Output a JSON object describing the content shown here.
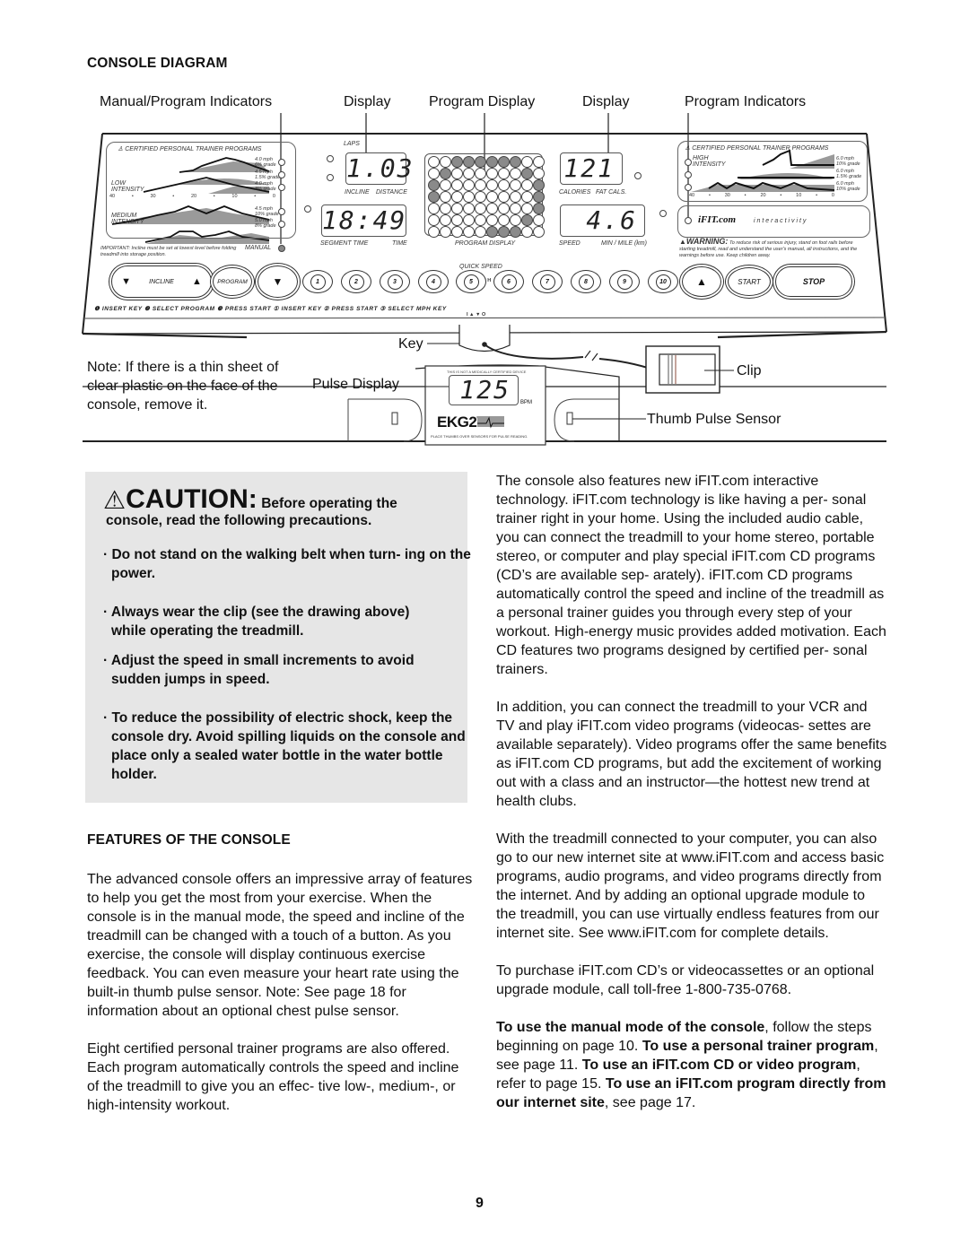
{
  "page": {
    "number": "9"
  },
  "console_diagram": {
    "heading": "CONSOLE DIAGRAM",
    "callouts_top": [
      "Manual/Program Indicators",
      "Display",
      "Program Display",
      "Display",
      "Program Indicators"
    ],
    "callouts_bottom": {
      "key": "Key",
      "pulse_display": "Pulse Display",
      "clip": "Clip",
      "thumb_pulse_sensor": "Thumb Pulse Sensor"
    },
    "note": "Note: If there is a thin sheet of clear plastic on the face of the console, remove it.",
    "left_program_panel": {
      "title": "CERTIFIED PERSONAL TRAINER PROGRAMS",
      "low_label": "LOW INTENSITY",
      "medium_label": "MEDIUM INTENSITY",
      "axis_ticks": [
        "40",
        "•",
        "30",
        "•",
        "20",
        "•",
        "10",
        "•",
        "0"
      ],
      "programs": [
        {
          "speed": "4.0 mph",
          "grade": "6% grade"
        },
        {
          "speed": "4.5 mph",
          "grade": "1.5% grade"
        },
        {
          "speed": "4.0 mph",
          "grade": "8% grade"
        },
        {
          "speed": "4.5 mph",
          "grade": "10% grade"
        },
        {
          "speed": "5.0 mph",
          "grade": "8% grade"
        }
      ],
      "manual_label": "MANUAL",
      "important_note": "IMPORTANT: Incline must be set at lowest level before folding treadmill into storage position."
    },
    "displays": {
      "laps_label": "LAPS",
      "incline_label": "INCLINE",
      "distance_label": "DISTANCE",
      "distance_value": "1.03",
      "segment_time_label": "SEGMENT TIME",
      "time_label": "TIME",
      "time_value": "18:49",
      "program_display_label": "PROGRAM DISPLAY",
      "calories_label": "CALORIES",
      "fat_cals_label": "FAT CALS.",
      "calories_value": "121",
      "speed_label": "SPEED",
      "min_mile_label": "MIN / MILE (km)",
      "speed_value": "4.6"
    },
    "program_matrix": [
      [
        0,
        0,
        1,
        1,
        1,
        1,
        1,
        1,
        0,
        0
      ],
      [
        0,
        1,
        0,
        0,
        0,
        0,
        0,
        0,
        1,
        0
      ],
      [
        1,
        0,
        0,
        0,
        0,
        0,
        0,
        0,
        0,
        1
      ],
      [
        1,
        0,
        0,
        0,
        0,
        0,
        0,
        0,
        0,
        1
      ],
      [
        0,
        0,
        0,
        0,
        0,
        0,
        0,
        0,
        0,
        1
      ],
      [
        0,
        0,
        0,
        0,
        0,
        0,
        0,
        0,
        1,
        0
      ],
      [
        0,
        0,
        0,
        0,
        0,
        1,
        1,
        1,
        0,
        0
      ]
    ],
    "right_program_panel": {
      "title": "CERTIFIED PERSONAL TRAINER PROGRAMS",
      "high_label": "HIGH INTENSITY",
      "axis_ticks": [
        "40",
        "•",
        "30",
        "•",
        "20",
        "•",
        "10",
        "•",
        "0"
      ],
      "programs": [
        {
          "speed": "6.0 mph",
          "grade": "10% grade"
        },
        {
          "speed": "6.0 mph",
          "grade": "1.5% grade"
        },
        {
          "speed": "6.0 mph",
          "grade": "10% grade"
        }
      ],
      "ifit_logo": "iFIT.com",
      "interactivity": "i n t e r a c t i v i t y",
      "warning_title": "WARNING:",
      "warning_text": "To reduce risk of serious injury, stand on foot rails before starting treadmill, read and understand the user's manual, all instructions, and the warnings before use. Keep children away."
    },
    "keys": {
      "incline_label": "INCLINE",
      "program_label": "PROGRAM",
      "quick_speed_label": "QUICK SPEED",
      "mph_label": "M P H",
      "quick_speeds": [
        "1",
        "2",
        "3",
        "4",
        "5",
        "6",
        "7",
        "8",
        "9",
        "10"
      ],
      "start_label": "START",
      "stop_label": "STOP"
    },
    "instruction_strip": "❶ INSERT KEY ❷ SELECT PROGRAM ❸ PRESS START  ① INSERT KEY ② PRESS START ③ SELECT MPH KEY",
    "key_slot_marks": "I ▲   ▼ O",
    "pulse_unit": {
      "disclaimer": "THIS IS NOT A MEDICALLY CERTIFIED DEVICE",
      "value": "125",
      "unit": "BPM",
      "brand": "EKG2",
      "brand_sup": "V",
      "instruction": "PLACE THUMBS OVER SENSORS FOR PULSE READING."
    }
  },
  "caution": {
    "title": "CAUTION:",
    "lead_inline": "Before operating the",
    "lead_line2": "console, read the following precautions.",
    "bullets": [
      "Do not stand on the walking belt when turn- ing on the power.",
      "Always wear the clip (see the drawing above) while operating the treadmill.",
      "Adjust the speed in small increments to avoid sudden jumps in speed.",
      "To reduce the possibility of electric shock, keep the console dry. Avoid spilling liquids on the console and place only a sealed water bottle in the water bottle holder."
    ]
  },
  "features": {
    "heading": "FEATURES OF THE CONSOLE",
    "left_paragraphs": [
      "The advanced console offers an impressive array of features to help you get the most from your exercise. When the console is in the manual mode, the speed and incline of the treadmill can be changed with a touch of a button. As you exercise, the console will display continuous exercise feedback. You can even measure your heart rate using the built-in thumb pulse sensor. Note: See page 18 for information about an optional chest pulse sensor.",
      "Eight certified personal trainer programs are also offered. Each program automatically controls the speed and incline of the treadmill to give you an effec- tive low-, medium-, or high-intensity workout."
    ],
    "right_paragraphs": [
      "The console also features new iFIT.com interactive technology. iFIT.com technology is like having a per- sonal trainer right in your home. Using the included audio cable, you can connect the treadmill to your home stereo, portable stereo, or computer and play special iFIT.com CD programs (CD’s are available sep- arately). iFIT.com CD programs automatically control the speed and incline of the treadmill as a personal trainer guides you through every step of your workout. High-energy music provides added motivation. Each CD features two programs designed by certified per- sonal trainers.",
      "In addition, you can connect the treadmill to your VCR and TV and play iFIT.com video programs (videocas- settes are available separately). Video programs offer the same benefits as iFIT.com CD programs, but add the excitement of working out with a class and an instructor—the hottest new trend at health clubs.",
      "With the treadmill connected to your computer, you can also go to our new internet site at www.iFIT.com and access basic programs, audio programs, and video programs directly from the internet. And by adding an optional upgrade module to the treadmill, you can use virtually endless features from our internet site. See www.iFIT.com for complete details.",
      "To purchase iFIT.com CD’s or videocassettes or an optional upgrade module, call toll-free 1-800-735-0768."
    ],
    "final_paragraph": {
      "b1": "To use the manual mode of the console",
      "t1": ", follow the steps beginning on page 10. ",
      "b2": "To use a personal trainer program",
      "t2": ", see page 11. ",
      "b3": "To use an iFIT.com CD or video program",
      "t3": ", refer to page 15. ",
      "b4": "To use an iFIT.com program directly from our internet site",
      "t4": ", see page 17."
    }
  }
}
